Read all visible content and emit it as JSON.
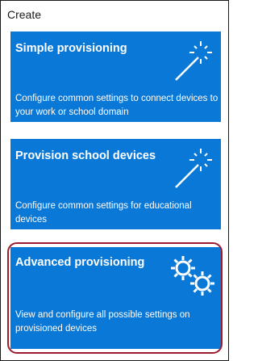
{
  "header": {
    "title": "Create"
  },
  "tiles": [
    {
      "title": "Simple provisioning",
      "description": "Configure common settings to connect devices to your work or school domain",
      "icon": "magic-wand-icon"
    },
    {
      "title": "Provision school devices",
      "description": "Configure common settings for educational devices",
      "icon": "magic-wand-icon"
    },
    {
      "title": "Advanced provisioning",
      "description": "View and configure all possible settings on provisioned devices",
      "icon": "gears-icon"
    }
  ],
  "colors": {
    "tile_background": "#0a78d7",
    "highlight_border": "#9b1b30",
    "window_border": "#1a1a1a"
  }
}
